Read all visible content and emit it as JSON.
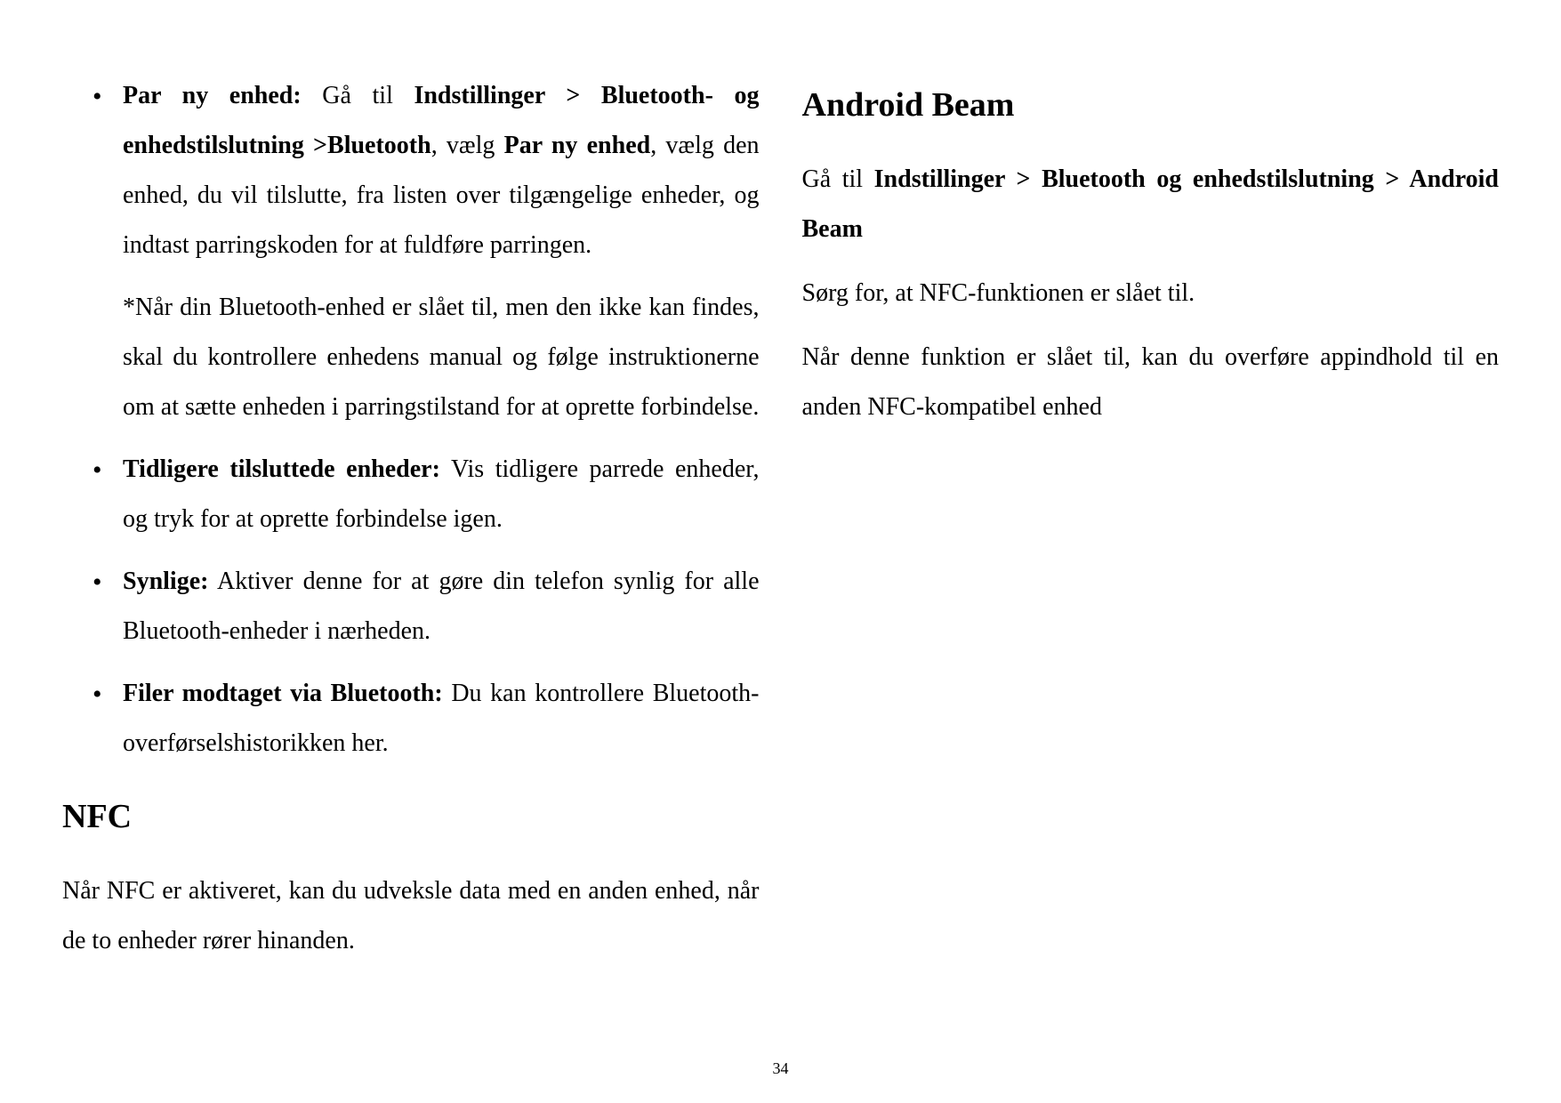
{
  "page_number": "34",
  "col1": {
    "b1": {
      "label": "Par ny enhed:",
      "t1": " Gå til ",
      "path": "Indstillinger > Bluetooth- og enhedstilslutning >Bluetooth",
      "t2": ", vælg ",
      "action": "Par ny enhed",
      "t3": ", vælg den enhed, du vil tilslutte, fra listen over tilgængelige enheder, og indtast parringskoden for at fuldføre parringen.",
      "note": "*Når din Bluetooth-enhed er slået til, men den ikke kan findes, skal du kontrollere enhedens manual og følge instruktionerne om at sætte enheden i parringstilstand for at oprette forbindelse."
    },
    "b2": {
      "label": "Tidligere tilsluttede enheder:",
      "text": " Vis tidligere parrede enheder, og tryk for at oprette forbindelse igen."
    },
    "b3": {
      "label": "Synlige:",
      "text": " Aktiver denne for at gøre din telefon synlig for alle Bluetooth-enheder i nærheden."
    },
    "b4": {
      "label": "Filer modtaget via Bluetooth:",
      "text": " Du kan kontrollere Bluetooth- overførselshistorikken her."
    }
  },
  "nfc": {
    "heading": "NFC",
    "text": "Når NFC er aktiveret, kan du udveksle data med en anden enhed, når de to enheder rører hinanden."
  },
  "beam": {
    "heading": "Android Beam",
    "intro_pre": "Gå til ",
    "intro_bold": "Indstillinger > Bluetooth og enhedstilslutning > Android Beam",
    "p2": "Sørg for, at NFC-funktionen er slået til.",
    "p3": "Når denne funktion er slået til, kan du overføre appindhold til en anden NFC-kompatibel enhed"
  }
}
